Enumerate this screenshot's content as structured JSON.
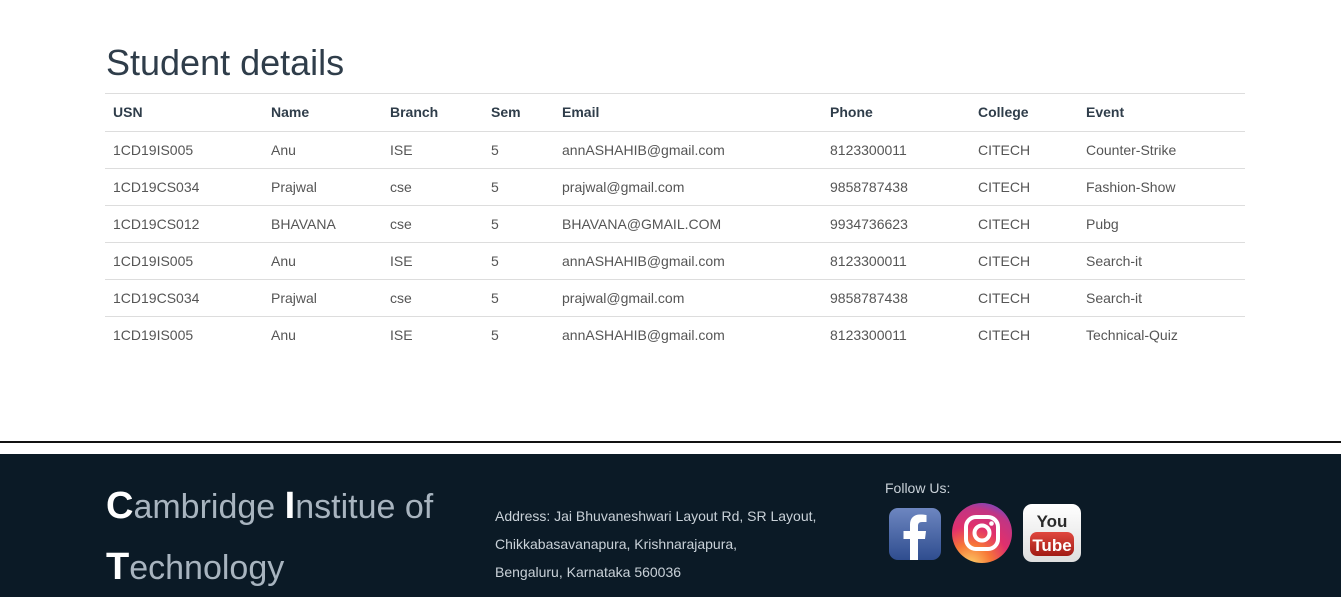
{
  "page": {
    "title": "Student details"
  },
  "table": {
    "headers": [
      "USN",
      "Name",
      "Branch",
      "Sem",
      "Email",
      "Phone",
      "College",
      "Event"
    ],
    "rows": [
      [
        "1CD19IS005",
        "Anu",
        "ISE",
        "5",
        "annASHAHIB@gmail.com",
        "8123300011",
        "CITECH",
        "Counter-Strike"
      ],
      [
        "1CD19CS034",
        "Prajwal",
        "cse",
        "5",
        "prajwal@gmail.com",
        "9858787438",
        "CITECH",
        "Fashion-Show"
      ],
      [
        "1CD19CS012",
        "BHAVANA",
        "cse",
        "5",
        "BHAVANA@GMAIL.COM",
        "9934736623",
        "CITECH",
        "Pubg"
      ],
      [
        "1CD19IS005",
        "Anu",
        "ISE",
        "5",
        "annASHAHIB@gmail.com",
        "8123300011",
        "CITECH",
        "Search-it"
      ],
      [
        "1CD19CS034",
        "Prajwal",
        "cse",
        "5",
        "prajwal@gmail.com",
        "9858787438",
        "CITECH",
        "Search-it"
      ],
      [
        "1CD19IS005",
        "Anu",
        "ISE",
        "5",
        "annASHAHIB@gmail.com",
        "8123300011",
        "CITECH",
        "Technical-Quiz"
      ]
    ]
  },
  "footer": {
    "brand": {
      "w1_cap": "C",
      "w1_rest": "ambridge ",
      "w2_cap": "I",
      "w2_rest": "nstitue of",
      "w3_cap": "T",
      "w3_rest": "echnology"
    },
    "address": {
      "line1": "Address: Jai Bhuvaneshwari Layout Rd, SR Layout,",
      "line2": "Chikkabasavanapura, Krishnarajapura,",
      "line3": "Bengaluru, Karnataka 560036"
    },
    "follow_label": "Follow Us:",
    "socials": [
      {
        "icon": "facebook-icon",
        "color": "#3b5998"
      },
      {
        "icon": "instagram-icon",
        "color": "#e1306c"
      },
      {
        "icon": "youtube-icon",
        "color": "#c4302b"
      }
    ],
    "youtube_text": {
      "you": "You",
      "tube": "Tube"
    }
  },
  "colors": {
    "footer_bg": "#0b1a26",
    "title": "#2f3d4a"
  }
}
